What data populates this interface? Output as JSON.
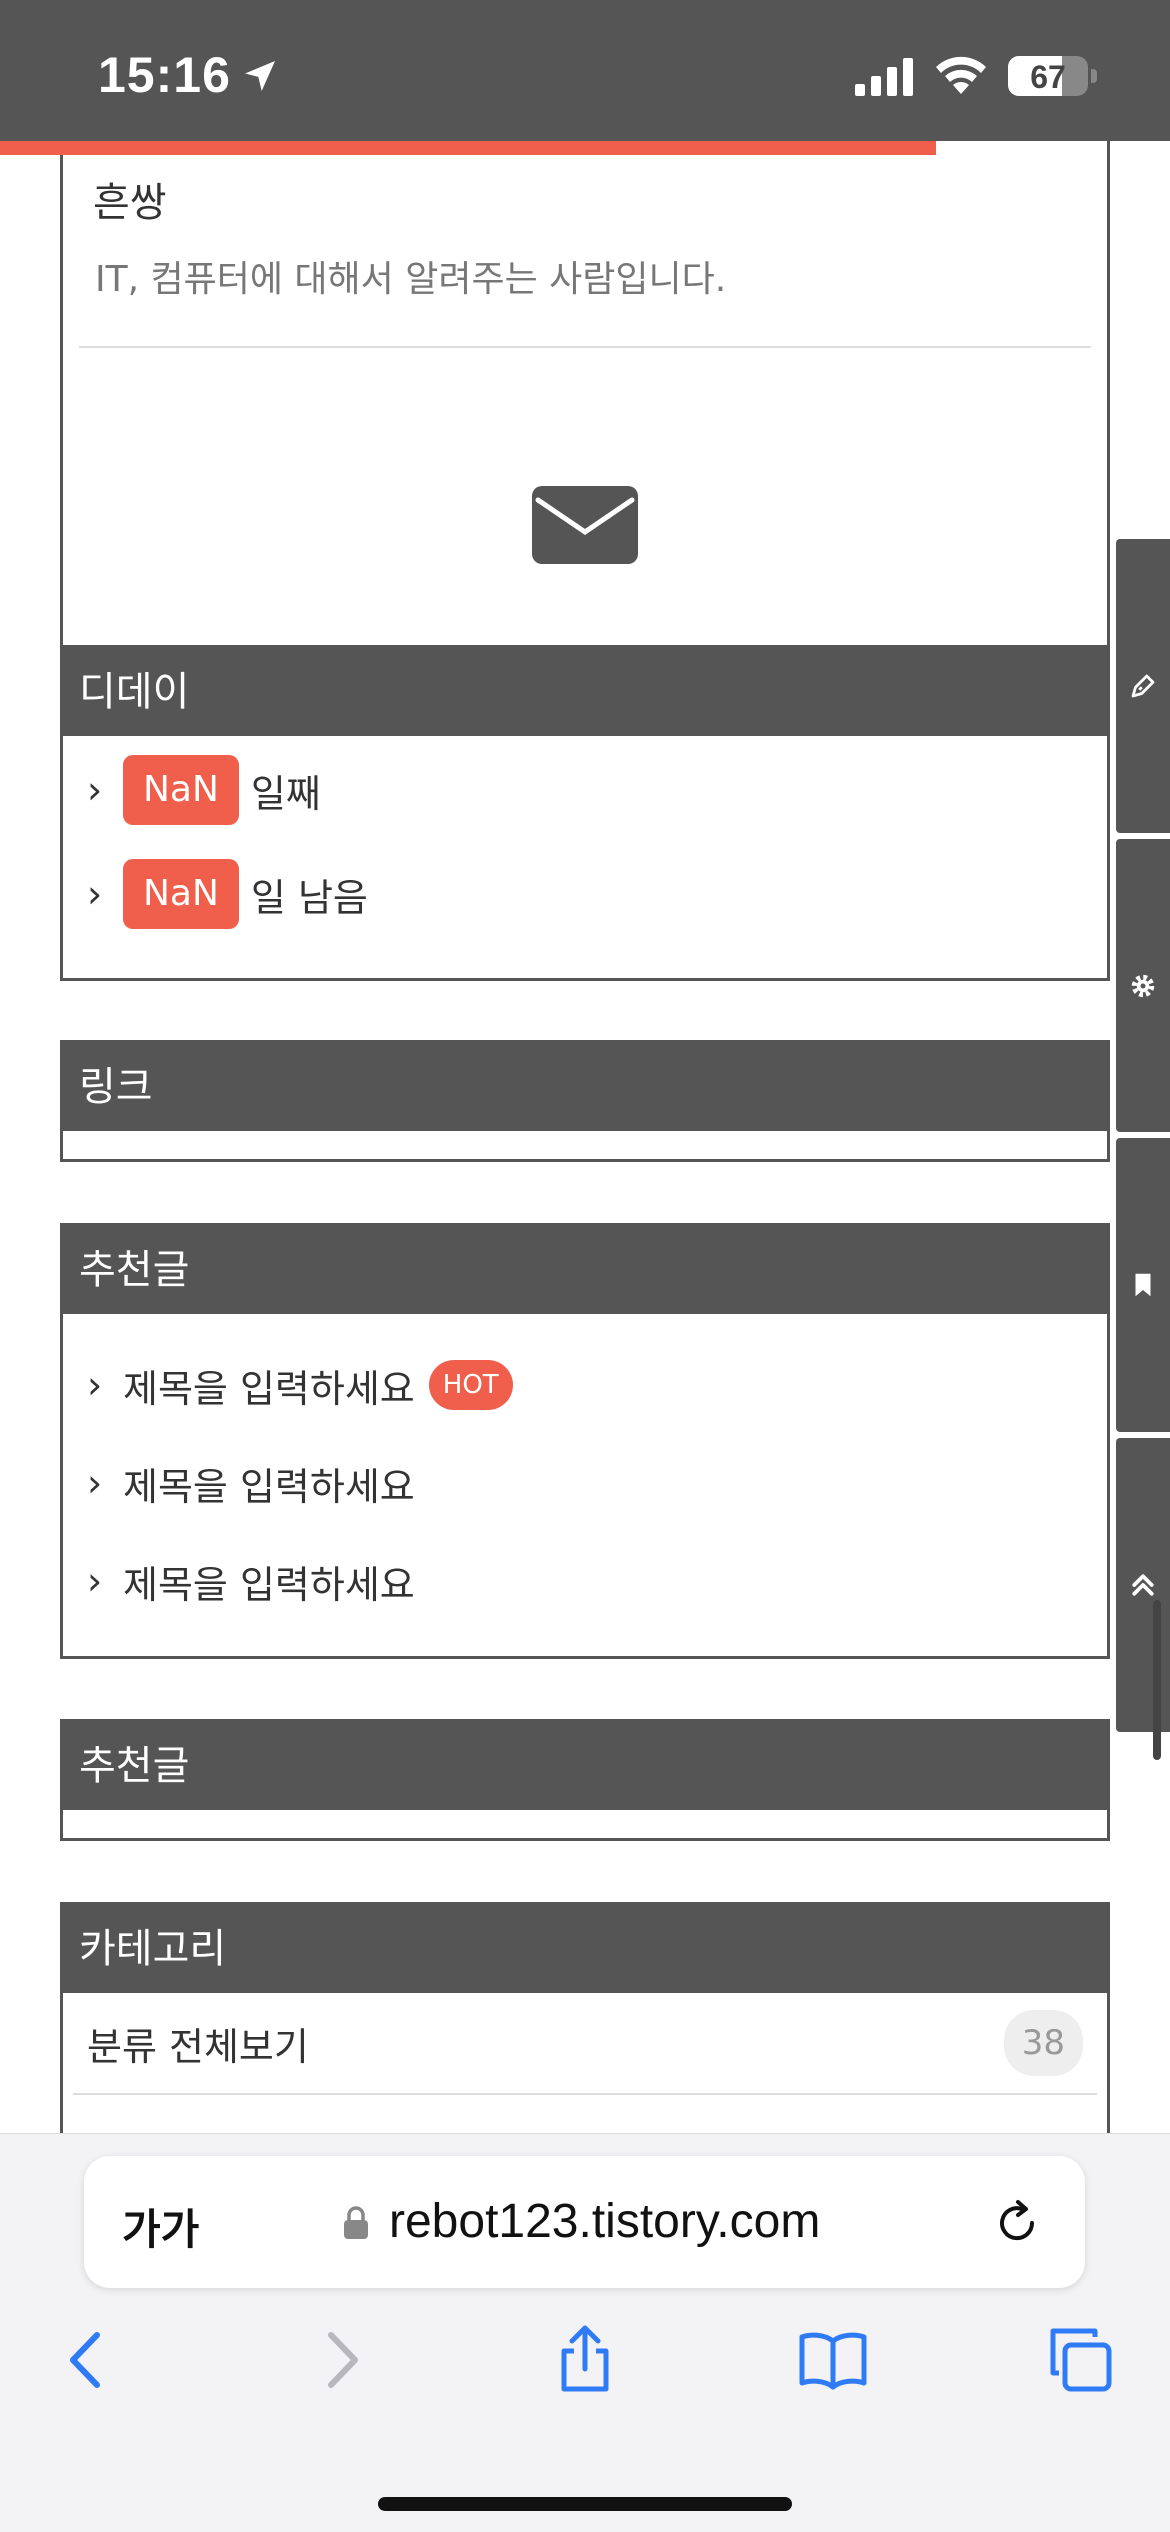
{
  "status_bar": {
    "time": "15:16",
    "battery": "67",
    "battery_level": 0.67
  },
  "reading_progress": 0.8,
  "profile": {
    "name": "흔쌍",
    "description": "IT, 컴퓨터에 대해서 알려주는 사람입니다.",
    "mail_icon": "envelope-icon"
  },
  "dday": {
    "title": "디데이",
    "items": [
      {
        "badge": "NaN",
        "text": "일째"
      },
      {
        "badge": "NaN",
        "text": "일 남음"
      }
    ]
  },
  "links": {
    "title": "링크"
  },
  "recommended": {
    "title": "추천글",
    "items": [
      {
        "text": "제목을 입력하세요",
        "badge": "HOT"
      },
      {
        "text": "제목을 입력하세요"
      },
      {
        "text": "제목을 입력하세요"
      }
    ]
  },
  "recommended2": {
    "title": "추천글"
  },
  "category": {
    "title": "카테고리",
    "items": [
      {
        "label": "분류 전체보기",
        "count": "38"
      }
    ]
  },
  "side_toolbar": [
    "pen-icon",
    "gear-icon",
    "bookmark-icon",
    "double-chevron-up-icon"
  ],
  "safari": {
    "text_size_label": "가가",
    "url": "rebot123.tistory.com"
  },
  "colors": {
    "header_bg": "#555555",
    "accent": "#ef5f4c",
    "link_blue": "#2f7bf5"
  }
}
